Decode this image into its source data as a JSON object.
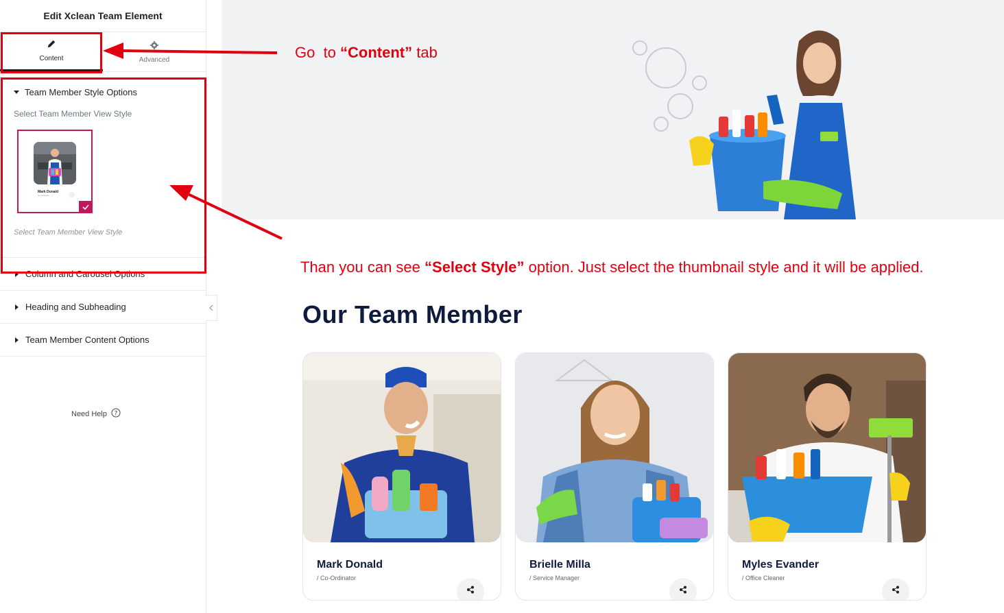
{
  "panel": {
    "title": "Edit Xclean Team Element",
    "tabs": [
      {
        "label": "Content",
        "icon": "pencil-icon",
        "active": true
      },
      {
        "label": "Advanced",
        "icon": "gear-icon",
        "active": false
      }
    ],
    "sections": [
      {
        "label": "Team Member Style Options",
        "open": true,
        "control_label": "Select Team Member View Style",
        "control_desc": "Select Team Member View Style",
        "thumbnail": {
          "name": "Mark Donald",
          "role": "Co-Ordinator",
          "selected": true
        }
      },
      {
        "label": "Column and Carousel Options",
        "open": false
      },
      {
        "label": "Heading and Subheading",
        "open": false
      },
      {
        "label": "Team Member Content Options",
        "open": false
      }
    ],
    "need_help": "Need Help"
  },
  "annotations": {
    "content_tab": {
      "prefix": "Go  to ",
      "bold": "“Content”",
      "suffix": " tab"
    },
    "select_style": {
      "prefix": "Than you can see ",
      "bold": "“Select Style”",
      "suffix": " option. Just select the thumbnail style and it will be applied."
    },
    "color": "#e1000f"
  },
  "preview": {
    "section_title": "Our Team Member",
    "members": [
      {
        "name": "Mark Donald",
        "role": "/ Co-Ordinator"
      },
      {
        "name": "Brielle Milla",
        "role": "/ Service Manager"
      },
      {
        "name": "Myles Evander",
        "role": "/ Office Cleaner"
      }
    ]
  },
  "colors": {
    "accent": "#c2185b",
    "annotation": "#e1000f",
    "heading": "#0e1b3d"
  }
}
